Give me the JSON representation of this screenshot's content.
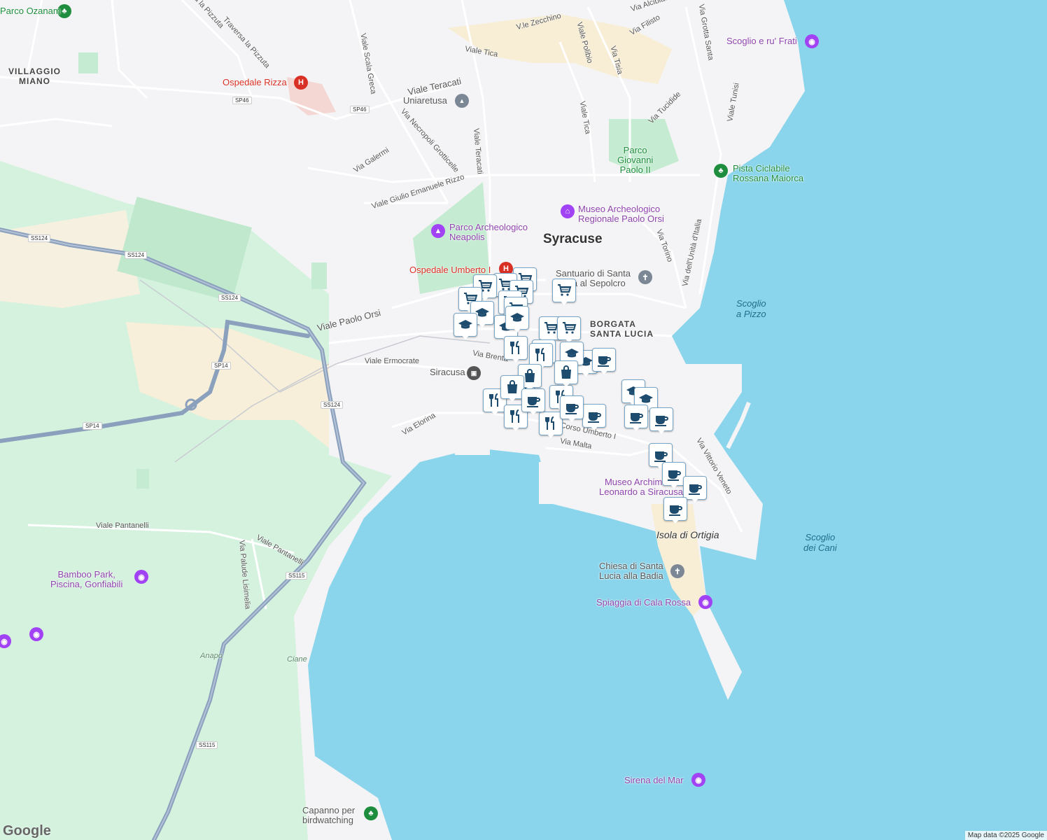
{
  "city_label": "Syracuse",
  "districts": [
    {
      "text": "VILLAGGIO\nMIANO"
    },
    {
      "text": "BORGATA\nSANTA LUCIA"
    }
  ],
  "roads": [
    {
      "text": "Via la Pizzuta"
    },
    {
      "text": "Traversa la Pizzuta"
    },
    {
      "text": "Viale Scala Greca"
    },
    {
      "text": "Viale Teracati"
    },
    {
      "text": "Via Necropoli Grotticelle"
    },
    {
      "text": "Via Galermi"
    },
    {
      "text": "Viale Giulio Emanuele Rizzo"
    },
    {
      "text": "Viale Teracati"
    },
    {
      "text": "Viale Tica"
    },
    {
      "text": "V.le Zecchino"
    },
    {
      "text": "Viale Polibio"
    },
    {
      "text": "Via Tisia"
    },
    {
      "text": "Viale Tica"
    },
    {
      "text": "Via Filisto"
    },
    {
      "text": "Via Alcibiade"
    },
    {
      "text": "Via Grotta Santa"
    },
    {
      "text": "Via Tucidide"
    },
    {
      "text": "Viale Tunisi"
    },
    {
      "text": "Via Torino"
    },
    {
      "text": "Via dell'Unità d'Italia"
    },
    {
      "text": "Viale Paolo Orsi"
    },
    {
      "text": "Viale Ermocrate"
    },
    {
      "text": "Via Brenta"
    },
    {
      "text": "Via Elorina"
    },
    {
      "text": "Via Malta"
    },
    {
      "text": "Corso Umberto I"
    },
    {
      "text": "Via Vittorio Veneto"
    },
    {
      "text": "Viale Pantanelli"
    },
    {
      "text": "Viale Pantanelli"
    },
    {
      "text": "Via Palude Lisimelia"
    },
    {
      "text": "Anapo"
    },
    {
      "text": "Ciane"
    }
  ],
  "road_badges": [
    "SP46",
    "SP46",
    "SS124",
    "SS124",
    "SS124",
    "SP14",
    "SS124",
    "SP14",
    "SS115",
    "SS115"
  ],
  "sea_labels": [
    {
      "text": "Scoglio\na Pizzo"
    },
    {
      "text": "Scoglio\ndei Cani"
    },
    {
      "text": "Isola di Ortigia"
    }
  ],
  "pois": [
    {
      "text": "Parco Ozanam",
      "icon": "tree-icon",
      "color": "#1e8e3e"
    },
    {
      "text": "Ospedale Rizza",
      "icon": "hospital-icon",
      "color": "#d93025"
    },
    {
      "text": "Uniaretusa",
      "icon": "school-icon",
      "color": "#7b8794"
    },
    {
      "text": "Parco\nGiovanni\nPaolo II",
      "icon": "",
      "color": "#1e8e3e"
    },
    {
      "text": "Pista Ciclabile\nRossana Maiorca",
      "icon": "tree-icon",
      "color": "#1e8e3e"
    },
    {
      "text": "Scoglio e ru' Frati",
      "icon": "camera-icon",
      "color": "#a142f4"
    },
    {
      "text": "Museo Archeologico\nRegionale Paolo Orsi",
      "icon": "museum-icon",
      "color": "#a142f4"
    },
    {
      "text": "Parco Archeologico\nNeapolis",
      "icon": "monument-icon",
      "color": "#a142f4"
    },
    {
      "text": "Ospedale Umberto I",
      "icon": "hospital-icon",
      "color": "#d93025"
    },
    {
      "text": "Santuario di Santa\nLucia al Sepolcro",
      "icon": "church-icon",
      "color": "#7b8794"
    },
    {
      "text": "Siracusa",
      "icon": "train-icon",
      "color": "#555555"
    },
    {
      "text": "Museo Archimede\nLeonardo a Siracusa",
      "icon": "museum-icon",
      "color": "#a142f4"
    },
    {
      "text": "Chiesa di Santa\nLucia alla Badia",
      "icon": "church-icon",
      "color": "#7b8794"
    },
    {
      "text": "Spiaggia di Cala Rossa",
      "icon": "camera-icon",
      "color": "#a142f4"
    },
    {
      "text": "Sirena del Mar",
      "icon": "camera-icon",
      "color": "#a142f4"
    },
    {
      "text": "Bamboo Park,\nPiscina, Gonfiabili",
      "icon": "camera-icon",
      "color": "#a142f4"
    },
    {
      "text": "Capanno per\nbirdwatching",
      "icon": "tree-icon",
      "color": "#1e8e3e"
    }
  ],
  "pins": [
    {
      "icon": "cart-icon"
    },
    {
      "icon": "cart-icon"
    },
    {
      "icon": "cart-icon"
    },
    {
      "icon": "cart-icon"
    },
    {
      "icon": "cart-icon"
    },
    {
      "icon": "cart-icon"
    },
    {
      "icon": "cart-icon"
    },
    {
      "icon": "cart-icon"
    },
    {
      "icon": "cart-icon"
    },
    {
      "icon": "cart-icon"
    },
    {
      "icon": "school-icon"
    },
    {
      "icon": "school-icon"
    },
    {
      "icon": "school-icon"
    },
    {
      "icon": "school-icon"
    },
    {
      "icon": "school-icon"
    },
    {
      "icon": "school-icon"
    },
    {
      "icon": "school-icon"
    },
    {
      "icon": "school-icon"
    },
    {
      "icon": "school-icon"
    },
    {
      "icon": "restaurant-icon"
    },
    {
      "icon": "restaurant-icon"
    },
    {
      "icon": "restaurant-icon"
    },
    {
      "icon": "restaurant-icon"
    },
    {
      "icon": "restaurant-icon"
    },
    {
      "icon": "restaurant-icon"
    },
    {
      "icon": "restaurant-icon"
    },
    {
      "icon": "shopping-bag-icon"
    },
    {
      "icon": "shopping-bag-icon"
    },
    {
      "icon": "shopping-bag-icon"
    },
    {
      "icon": "cafe-icon"
    },
    {
      "icon": "cafe-icon"
    },
    {
      "icon": "cafe-icon"
    },
    {
      "icon": "cafe-icon"
    },
    {
      "icon": "cafe-icon"
    },
    {
      "icon": "cafe-icon"
    },
    {
      "icon": "cafe-icon"
    },
    {
      "icon": "cafe-icon"
    },
    {
      "icon": "cafe-icon"
    },
    {
      "icon": "cafe-icon"
    }
  ],
  "colors": {
    "sea": "#8ad5ec",
    "land": "#f4f4f6",
    "park": "#cfeed9",
    "highway": "#8aa0bd",
    "pin_icon": "#1e4c6e"
  },
  "logo": "Google",
  "attribution": "Map data ©2025 Google"
}
